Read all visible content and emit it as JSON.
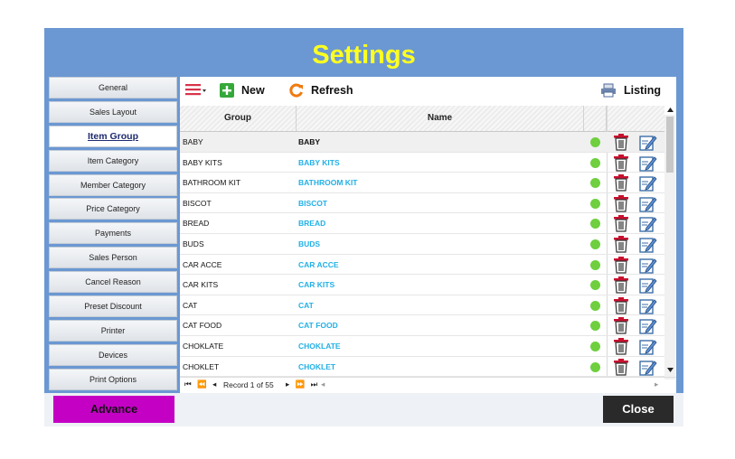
{
  "window": {
    "title": "Settings"
  },
  "sidebar": {
    "items": [
      {
        "label": "General"
      },
      {
        "label": "Sales Layout"
      },
      {
        "label": "Item Group"
      },
      {
        "label": "Item Category"
      },
      {
        "label": "Member Category"
      },
      {
        "label": "Price Category"
      },
      {
        "label": "Payments"
      },
      {
        "label": "Sales Person"
      },
      {
        "label": "Cancel Reason"
      },
      {
        "label": "Preset Discount"
      },
      {
        "label": "Printer"
      },
      {
        "label": "Devices"
      },
      {
        "label": "Print Options"
      }
    ],
    "active": "Item Group"
  },
  "toolbar": {
    "new_label": "New",
    "refresh_label": "Refresh",
    "listing_label": "Listing"
  },
  "grid": {
    "columns": [
      "Group",
      "Name"
    ],
    "rows": [
      {
        "group": "BABY",
        "name": "BABY"
      },
      {
        "group": "BABY KITS",
        "name": "BABY KITS"
      },
      {
        "group": "BATHROOM KIT",
        "name": "BATHROOM KIT"
      },
      {
        "group": "BISCOT",
        "name": "BISCOT"
      },
      {
        "group": "BREAD",
        "name": "BREAD"
      },
      {
        "group": "BUDS",
        "name": "BUDS"
      },
      {
        "group": "CAR ACCE",
        "name": "CAR ACCE"
      },
      {
        "group": "CAR KITS",
        "name": "CAR KITS"
      },
      {
        "group": "CAT",
        "name": "CAT"
      },
      {
        "group": "CAT FOOD",
        "name": "CAT FOOD"
      },
      {
        "group": "CHOKLATE",
        "name": "CHOKLATE"
      },
      {
        "group": "CHOKLET",
        "name": "CHOKLET"
      }
    ]
  },
  "navigator": {
    "record_text": "Record 1 of 55"
  },
  "footer": {
    "advance_label": "Advance",
    "close_label": "Close"
  },
  "colors": {
    "title": "#ffff21",
    "window": "#6b98d2",
    "name_link": "#22b0e6",
    "status_dot": "#6fcf3f",
    "advance": "#c400c4",
    "close": "#2a2a2a"
  }
}
